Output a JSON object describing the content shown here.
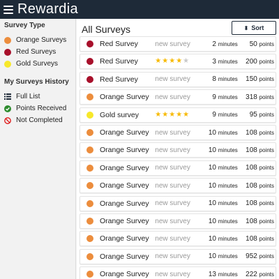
{
  "app": {
    "name": "Rewardia"
  },
  "colors": {
    "orange": "#ec8d3d",
    "red": "#a8102b",
    "gold": "#f7e82a",
    "star_on": "#f7b900",
    "star_off": "#c8c8c8",
    "topbar": "#1e2a38"
  },
  "sidebar": {
    "type_heading": "Survey Type",
    "types": [
      {
        "label": "Orange Surveys",
        "color": "#ec8d3d"
      },
      {
        "label": "Red Surveys",
        "color": "#a8102b"
      },
      {
        "label": "Gold Surveys",
        "color": "#f7e82a"
      }
    ],
    "history_heading": "My Surveys History",
    "history": [
      {
        "label": "Full List",
        "icon": "list-icon"
      },
      {
        "label": "Points Received",
        "icon": "check-circle-icon"
      },
      {
        "label": "Not Completed",
        "icon": "no-entry-icon"
      }
    ]
  },
  "main": {
    "title": "All Surveys",
    "sort_label": "Sort",
    "minutes_unit": "minutes",
    "points_unit": "points",
    "surveys": [
      {
        "name": "Red Survey",
        "type": "red",
        "status": "new survey",
        "stars": null,
        "minutes": "2",
        "points": "50"
      },
      {
        "name": "Red Survey",
        "type": "red",
        "status": "",
        "stars": 4,
        "minutes": "3",
        "points": "200"
      },
      {
        "name": "Red Survey",
        "type": "red",
        "status": "new survey",
        "stars": null,
        "minutes": "8",
        "points": "150"
      },
      {
        "name": "Orange Survey",
        "type": "orange",
        "status": "new survey",
        "stars": null,
        "minutes": "9",
        "points": "318"
      },
      {
        "name": "Gold survey",
        "type": "gold",
        "status": "",
        "stars": 5,
        "minutes": "9",
        "points": "95"
      },
      {
        "name": "Orange Survey",
        "type": "orange",
        "status": "new survey",
        "stars": null,
        "minutes": "10",
        "points": "108"
      },
      {
        "name": "Orange Survey",
        "type": "orange",
        "status": "new survey",
        "stars": null,
        "minutes": "10",
        "points": "108"
      },
      {
        "name": "Orange Survey",
        "type": "orange",
        "status": "new survey",
        "stars": null,
        "minutes": "10",
        "points": "108"
      },
      {
        "name": "Orange Survey",
        "type": "orange",
        "status": "new survey",
        "stars": null,
        "minutes": "10",
        "points": "108"
      },
      {
        "name": "Orange Survey",
        "type": "orange",
        "status": "new survey",
        "stars": null,
        "minutes": "10",
        "points": "108"
      },
      {
        "name": "Orange Survey",
        "type": "orange",
        "status": "new survey",
        "stars": null,
        "minutes": "10",
        "points": "108"
      },
      {
        "name": "Orange Survey",
        "type": "orange",
        "status": "new survey",
        "stars": null,
        "minutes": "10",
        "points": "108"
      },
      {
        "name": "Orange Survey",
        "type": "orange",
        "status": "new survey",
        "stars": null,
        "minutes": "10",
        "points": "952"
      },
      {
        "name": "Orange Survey",
        "type": "orange",
        "status": "new survey",
        "stars": null,
        "minutes": "13",
        "points": "222"
      }
    ]
  }
}
